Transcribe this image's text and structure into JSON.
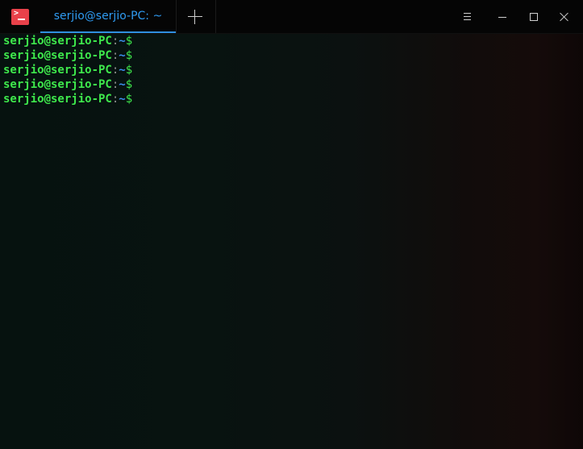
{
  "window": {
    "app_icon": "terminal-icon",
    "app_icon_glyph": ">_",
    "accent_color": "#2f8fe0",
    "controls": [
      "menu-icon",
      "minimize-icon",
      "maximize-icon",
      "close-icon"
    ]
  },
  "tabs": [
    {
      "label": "serjio@serjio-PC: ~",
      "active": true
    }
  ],
  "add_tab_icon": "plus-icon",
  "terminal": {
    "prompt_color": "#3ee84c",
    "path_color": "#3b8ff0",
    "lines": [
      {
        "user_host": "serjio@serjio-PC",
        "separator": ":",
        "path": "~",
        "symbol": "$"
      },
      {
        "user_host": "serjio@serjio-PC",
        "separator": ":",
        "path": "~",
        "symbol": "$"
      },
      {
        "user_host": "serjio@serjio-PC",
        "separator": ":",
        "path": "~",
        "symbol": "$"
      },
      {
        "user_host": "serjio@serjio-PC",
        "separator": ":",
        "path": "~",
        "symbol": "$"
      },
      {
        "user_host": "serjio@serjio-PC",
        "separator": ":",
        "path": "~",
        "symbol": "$"
      }
    ]
  }
}
